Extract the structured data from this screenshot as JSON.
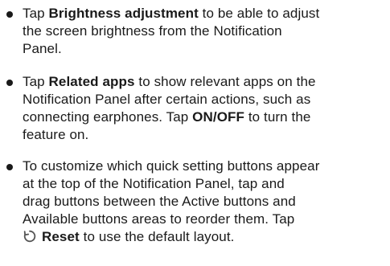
{
  "bullets": [
    {
      "lines": [
        {
          "pre": "Tap ",
          "bold": "Brightness adjustment",
          "post": " to be able to adjust"
        },
        {
          "text": "the screen brightness from the Notification"
        },
        {
          "text": "Panel."
        }
      ]
    },
    {
      "lines": [
        {
          "pre": "Tap ",
          "bold": "Related apps",
          "post": " to show relevant apps on the"
        },
        {
          "text": "Notification Panel after certain actions, such as"
        },
        {
          "pre": "connecting earphones. Tap ",
          "bold": "ON/OFF",
          "post": " to turn the"
        },
        {
          "text": "feature on."
        }
      ]
    },
    {
      "lines": [
        {
          "text": "To customize which quick setting buttons appear"
        },
        {
          "text": "at the top of the Notification Panel, tap and"
        },
        {
          "text": "drag buttons between the Active buttons and"
        },
        {
          "text": "Available buttons areas to reorder them. Tap"
        },
        {
          "icon": "reset-icon",
          "bold": "Reset",
          "post": " to use the default layout."
        }
      ]
    }
  ]
}
